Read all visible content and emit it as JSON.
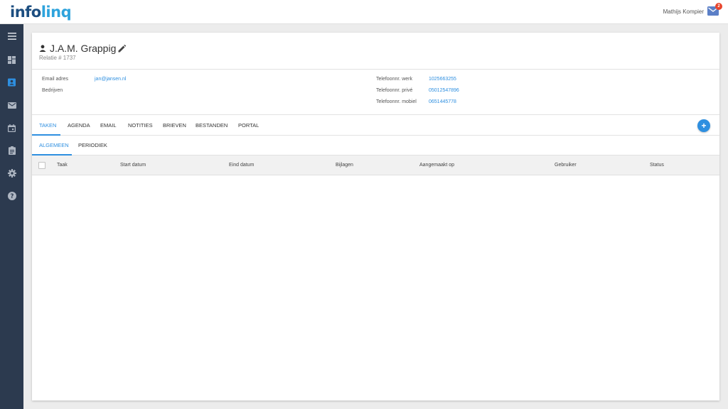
{
  "app": {
    "logo_part1": "info",
    "logo_part2": "linq",
    "user_name": "Mathijs Kompier",
    "notification_count": "2"
  },
  "colors": {
    "sidebar_bg": "#2c3a4f",
    "accent": "#2e8fe0",
    "badge": "#e8452c"
  },
  "sidebar": {
    "items": [
      {
        "icon": "menu-icon"
      },
      {
        "icon": "dashboard-icon"
      },
      {
        "icon": "contacts-icon",
        "active": true
      },
      {
        "icon": "mail-icon"
      },
      {
        "icon": "calendar-icon"
      },
      {
        "icon": "clipboard-icon"
      },
      {
        "icon": "gear-icon"
      },
      {
        "icon": "help-icon"
      }
    ]
  },
  "contact": {
    "name": "J.A.M. Grappig",
    "relation": "Relatie # 1737",
    "fields_left": [
      {
        "label": "Email adres",
        "value": "jan@jansen.nl"
      },
      {
        "label": "Bedrijven",
        "value": ""
      }
    ],
    "fields_right": [
      {
        "label": "Telefoonnr. werk",
        "value": "1025663255"
      },
      {
        "label": "Telefoonnr. privé",
        "value": "05012547896"
      },
      {
        "label": "Telefoonnr. mobiel",
        "value": "0651445778"
      }
    ]
  },
  "tabs": [
    "TAKEN",
    "AGENDA",
    "EMAIL",
    "NOTITIES",
    "BRIEVEN",
    "BESTANDEN",
    "PORTAL"
  ],
  "active_tab": "TAKEN",
  "subtabs": [
    "ALGEMEEN",
    "PERIODIEK"
  ],
  "active_subtab": "ALGEMEEN",
  "add_button": "+",
  "table": {
    "columns": [
      "Taak",
      "Start datum",
      "Eind datum",
      "Bijlagen",
      "Aangemaakt op",
      "Gebruiker",
      "Status"
    ],
    "rows": []
  }
}
